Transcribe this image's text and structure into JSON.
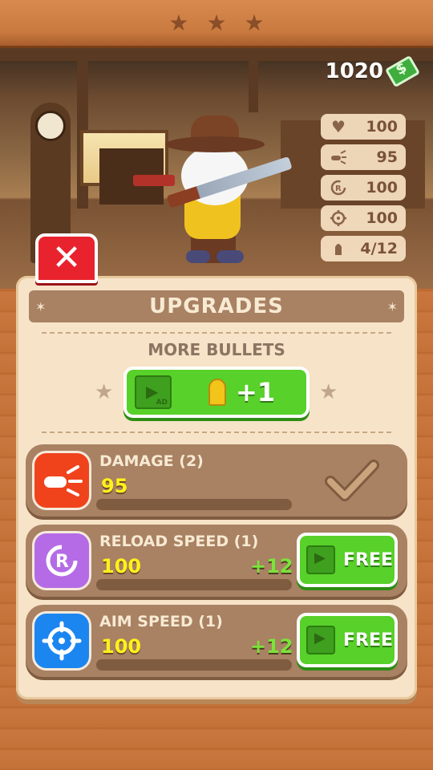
{
  "top_stars": [
    "★",
    "★",
    "★"
  ],
  "money": "1020",
  "stats": [
    {
      "icon": "heart-icon",
      "value": "100"
    },
    {
      "icon": "damage-icon",
      "value": "95"
    },
    {
      "icon": "reload-icon",
      "value": "100"
    },
    {
      "icon": "crosshair-icon",
      "value": "100"
    },
    {
      "icon": "bullet-icon",
      "value": "4/12"
    }
  ],
  "panel": {
    "title": "UPGRADES",
    "more_bullets_label": "MORE BULLETS",
    "ad_reward": "+1",
    "ad_tag": "AD"
  },
  "upgrades": [
    {
      "name": "DAMAGE (2)",
      "value": "95",
      "plus": "",
      "action": "maxed",
      "icon": "damage-icon",
      "color": "#f0431c"
    },
    {
      "name": "RELOAD SPEED (1)",
      "value": "100",
      "plus": "+12",
      "action": "FREE",
      "icon": "reload-icon",
      "color": "#b56be6"
    },
    {
      "name": "AIM SPEED (1)",
      "value": "100",
      "plus": "+12",
      "action": "FREE",
      "icon": "crosshair-icon",
      "color": "#1c86f0"
    }
  ]
}
